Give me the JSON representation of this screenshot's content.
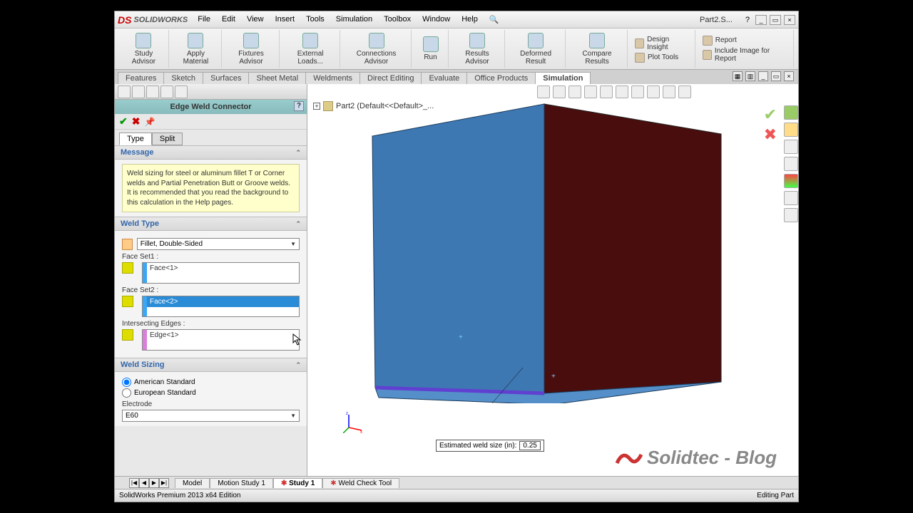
{
  "app": {
    "name": "SOLIDWORKS",
    "doc_title": "Part2.S...",
    "help_glyph": "?"
  },
  "menu": [
    "File",
    "Edit",
    "View",
    "Insert",
    "Tools",
    "Simulation",
    "Toolbox",
    "Window",
    "Help"
  ],
  "ribbon_buttons": [
    "Study Advisor",
    "Apply Material",
    "Fixtures Advisor",
    "External Loads...",
    "Connections Advisor",
    "Run",
    "Results Advisor",
    "Deformed Result",
    "Compare Results"
  ],
  "ribbon_lines": [
    "Design Insight",
    "Plot Tools",
    "Report",
    "Include Image for Report"
  ],
  "tabs": [
    "Features",
    "Sketch",
    "Surfaces",
    "Sheet Metal",
    "Weldments",
    "Direct Editing",
    "Evaluate",
    "Office Products",
    "Simulation"
  ],
  "tabs_active": 8,
  "pm": {
    "title": "Edge Weld Connector",
    "subtabs": [
      "Type",
      "Split"
    ],
    "subtabs_active": 0,
    "sections": {
      "message": {
        "header": "Message",
        "text": "Weld sizing for steel or aluminum fillet T or Corner welds and Partial Penetration Butt or Groove welds. It is recommended that you read the background to this calculation in the Help pages."
      },
      "weld_type": {
        "header": "Weld Type",
        "combo": "Fillet, Double-Sided",
        "faceset1_label": "Face Set1 :",
        "faceset1_value": "Face<1>",
        "faceset2_label": "Face Set2 :",
        "faceset2_value": "Face<2>",
        "intersect_label": "Intersecting Edges :",
        "intersect_value": "Edge<1>"
      },
      "weld_sizing": {
        "header": "Weld Sizing",
        "radio1": "American Standard",
        "radio2": "European Standard",
        "electrode_label": "Electrode",
        "electrode_value": "E60"
      }
    }
  },
  "tree_root": "Part2  (Default<<Default>_...",
  "est_label": "Estimated weld size (in):",
  "est_value": "0.25",
  "bottom_tabs": [
    "Model",
    "Motion Study 1",
    "Study 1",
    "Weld Check Tool"
  ],
  "bottom_active": 2,
  "status_left": "SolidWorks Premium 2013 x64 Edition",
  "status_right": "Editing Part",
  "watermark": "Solidtec - Blog"
}
